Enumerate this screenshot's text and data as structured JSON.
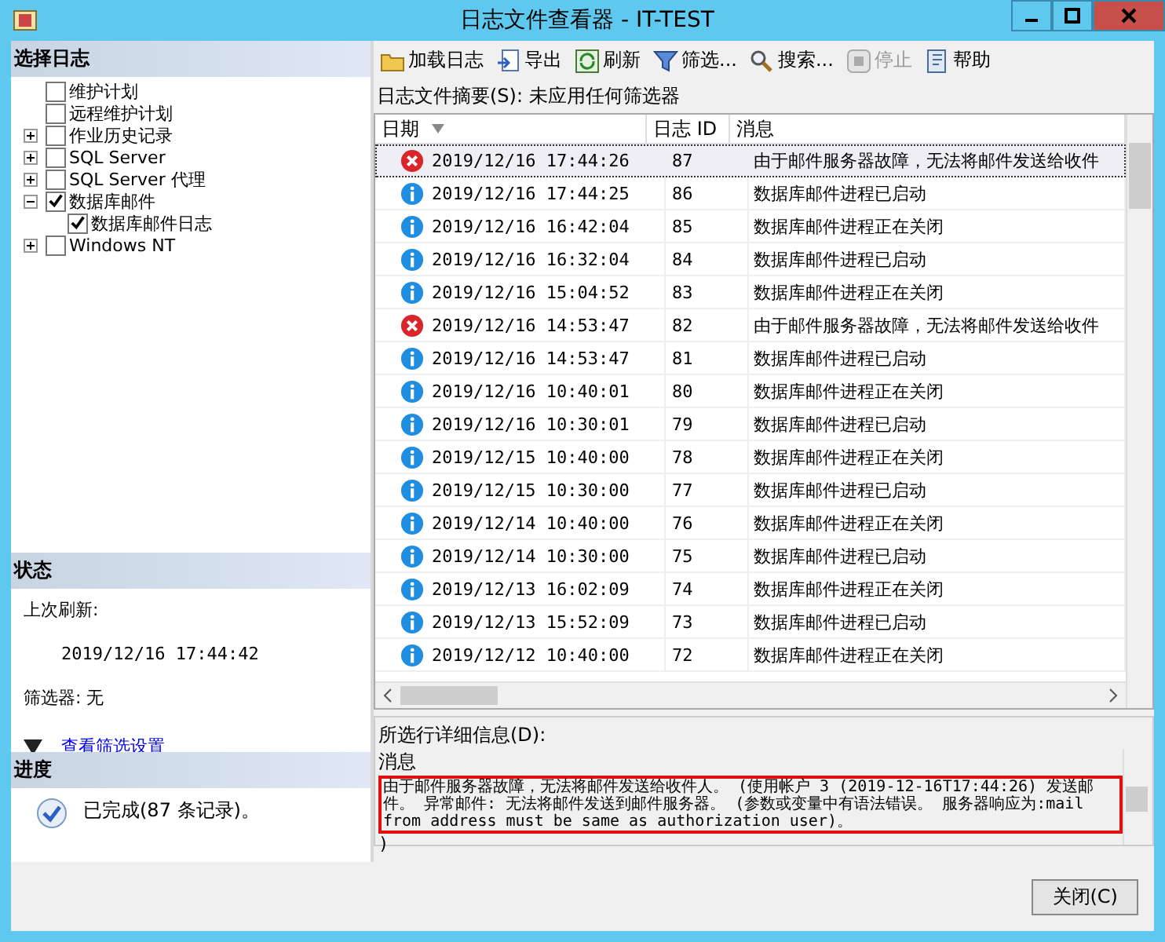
{
  "window": {
    "title": "日志文件查看器 - IT-TEST"
  },
  "select_log": {
    "title": "选择日志",
    "tree": [
      {
        "label": "维护计划",
        "checked": false
      },
      {
        "label": "远程维护计划",
        "checked": false
      },
      {
        "label": "作业历史记录",
        "checked": false,
        "expanded": false
      },
      {
        "label": "SQL Server",
        "checked": false,
        "expanded": false
      },
      {
        "label": "SQL Server 代理",
        "checked": false,
        "expanded": false
      },
      {
        "label": "数据库邮件",
        "checked": true,
        "expanded": true,
        "children": [
          {
            "label": "数据库邮件日志",
            "checked": true
          }
        ]
      },
      {
        "label": "Windows NT",
        "checked": false,
        "expanded": false
      }
    ]
  },
  "status": {
    "title": "状态",
    "last_refresh_label": "上次刷新:",
    "last_refresh": "2019/12/16 17:44:42",
    "filter": "筛选器: 无",
    "filter_link": "查看筛选设置"
  },
  "progress": {
    "title": "进度",
    "text": "已完成(87 条记录)。"
  },
  "toolbar": [
    {
      "label": "加载日志",
      "disabled": false
    },
    {
      "label": "导出",
      "disabled": false
    },
    {
      "label": "刷新",
      "disabled": false
    },
    {
      "label": "筛选...",
      "disabled": false
    },
    {
      "label": "搜索...",
      "disabled": false
    },
    {
      "label": "停止",
      "disabled": true
    },
    {
      "label": "帮助",
      "disabled": false
    }
  ],
  "summary": "日志文件摘要(S): 未应用任何筛选器",
  "table": {
    "columns": [
      "日期",
      "日志 ID",
      "消息"
    ],
    "rows": [
      {
        "kind": "error",
        "date": "2019/12/16 17:44:26",
        "id": "87",
        "message": "由于邮件服务器故障，无法将邮件发送给收件",
        "selected": true
      },
      {
        "kind": "info",
        "date": "2019/12/16 17:44:25",
        "id": "86",
        "message": "数据库邮件进程已启动",
        "selected": false
      },
      {
        "kind": "info",
        "date": "2019/12/16 16:42:04",
        "id": "85",
        "message": "数据库邮件进程正在关闭",
        "selected": false
      },
      {
        "kind": "info",
        "date": "2019/12/16 16:32:04",
        "id": "84",
        "message": "数据库邮件进程已启动",
        "selected": false
      },
      {
        "kind": "info",
        "date": "2019/12/16 15:04:52",
        "id": "83",
        "message": "数据库邮件进程正在关闭",
        "selected": false
      },
      {
        "kind": "error",
        "date": "2019/12/16 14:53:47",
        "id": "82",
        "message": "由于邮件服务器故障，无法将邮件发送给收件",
        "selected": false
      },
      {
        "kind": "info",
        "date": "2019/12/16 14:53:47",
        "id": "81",
        "message": "数据库邮件进程已启动",
        "selected": false
      },
      {
        "kind": "info",
        "date": "2019/12/16 10:40:01",
        "id": "80",
        "message": "数据库邮件进程正在关闭",
        "selected": false
      },
      {
        "kind": "info",
        "date": "2019/12/16 10:30:01",
        "id": "79",
        "message": "数据库邮件进程已启动",
        "selected": false
      },
      {
        "kind": "info",
        "date": "2019/12/15 10:40:00",
        "id": "78",
        "message": "数据库邮件进程正在关闭",
        "selected": false
      },
      {
        "kind": "info",
        "date": "2019/12/15 10:30:00",
        "id": "77",
        "message": "数据库邮件进程已启动",
        "selected": false
      },
      {
        "kind": "info",
        "date": "2019/12/14 10:40:00",
        "id": "76",
        "message": "数据库邮件进程正在关闭",
        "selected": false
      },
      {
        "kind": "info",
        "date": "2019/12/14 10:30:00",
        "id": "75",
        "message": "数据库邮件进程已启动",
        "selected": false
      },
      {
        "kind": "info",
        "date": "2019/12/13 16:02:09",
        "id": "74",
        "message": "数据库邮件进程正在关闭",
        "selected": false
      },
      {
        "kind": "info",
        "date": "2019/12/13 15:52:09",
        "id": "73",
        "message": "数据库邮件进程已启动",
        "selected": false
      },
      {
        "kind": "info",
        "date": "2019/12/12 10:40:00",
        "id": "72",
        "message": "数据库邮件进程正在关闭",
        "selected": false
      }
    ]
  },
  "details": {
    "label": "所选行详细信息(D):",
    "heading": "消息",
    "text": "由于邮件服务器故障，无法将邮件发送给收件人。 (使用帐户 3 (2019-12-16T17:44:26) 发送邮件。 异常邮件: 无法将邮件发送到邮件服务器。 (参数或变量中有语法错误。 服务器响应为:mail from address must be same as authorization user)。",
    "closing": ")"
  },
  "buttons": [
    {
      "label": "关闭(C)"
    }
  ]
}
